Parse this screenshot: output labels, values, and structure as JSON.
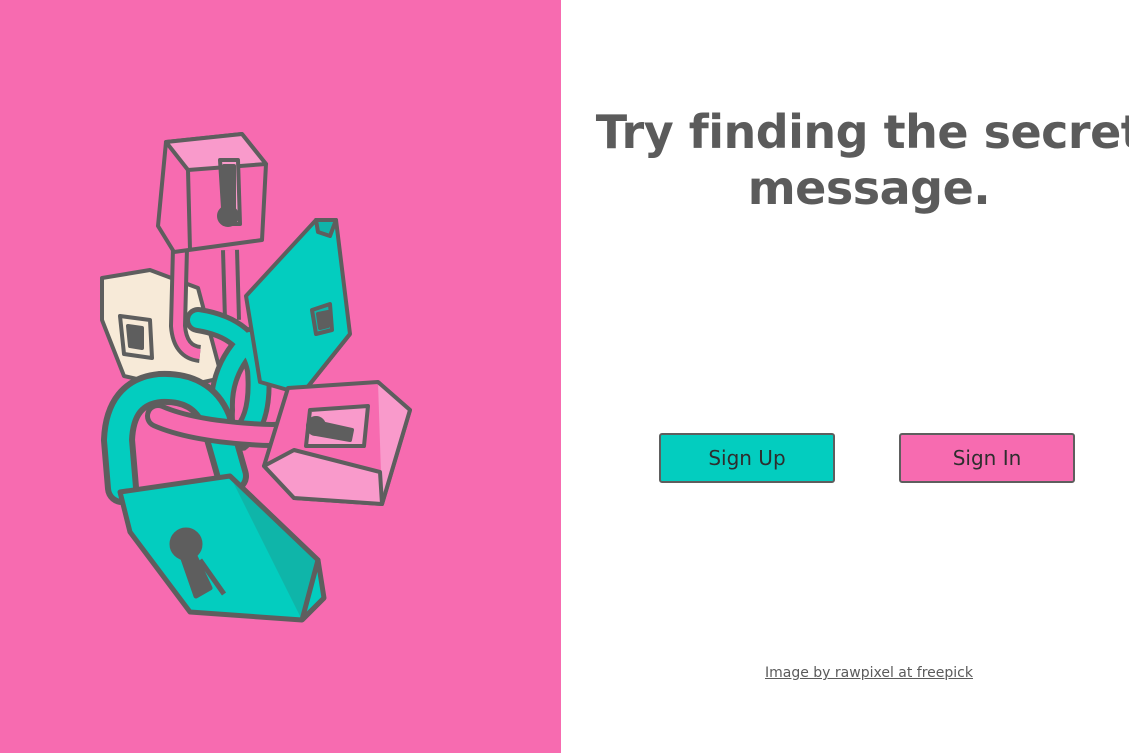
{
  "hero": {
    "headline": "Try finding the secret message."
  },
  "actions": {
    "sign_up_label": "Sign Up",
    "sign_in_label": "Sign In"
  },
  "footer": {
    "credit_text": "Image by rawpixel at freepick"
  },
  "colors": {
    "left_background": "#f76bb0",
    "teal": "#03cdbf",
    "pink": "#f76bb0",
    "cream": "#f7ead8",
    "outline": "#5e5e5e",
    "text": "#5b5b5b"
  },
  "illustration": {
    "icon": "padlocks-illustration"
  }
}
